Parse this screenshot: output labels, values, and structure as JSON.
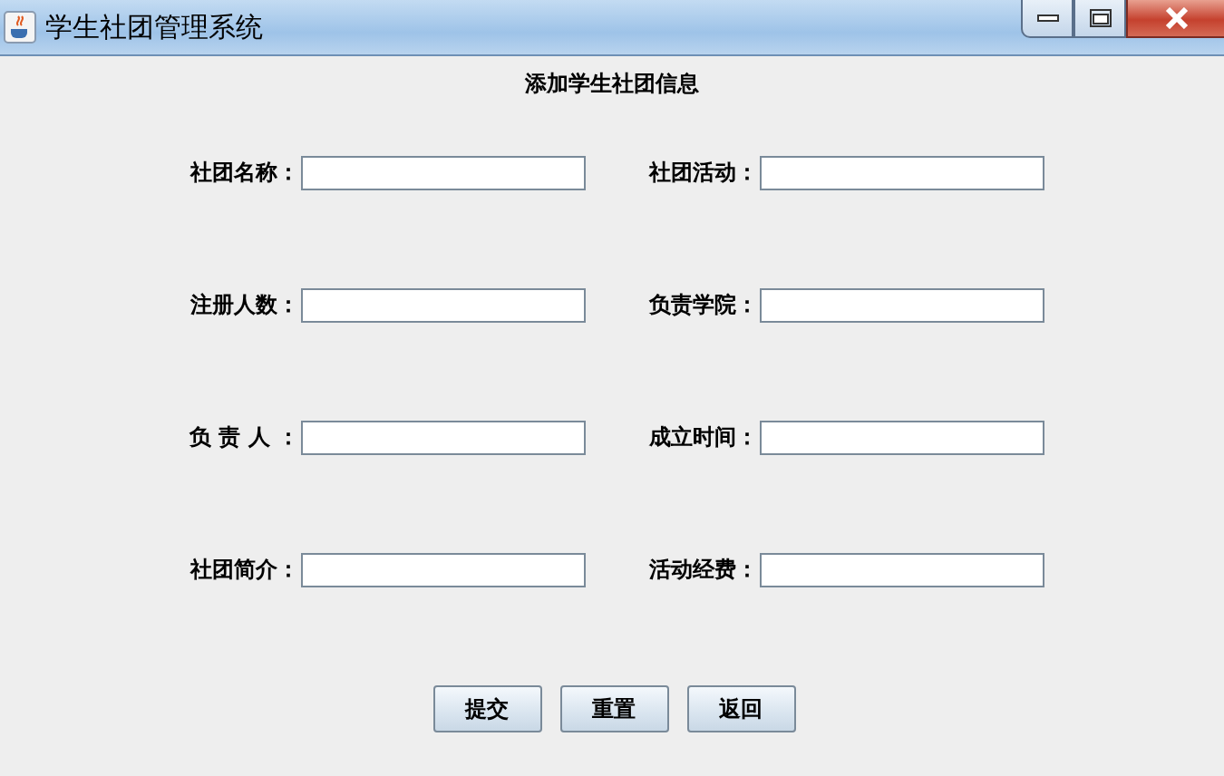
{
  "window": {
    "title": "学生社团管理系统"
  },
  "heading": "添加学生社团信息",
  "fields": [
    {
      "label": "社团名称："
    },
    {
      "label": "社团活动："
    },
    {
      "label": "注册人数："
    },
    {
      "label": "负责学院："
    },
    {
      "label": "负 责 人 ："
    },
    {
      "label": "成立时间："
    },
    {
      "label": "社团简介："
    },
    {
      "label": "活动经费："
    }
  ],
  "buttons": [
    "提交",
    "重置",
    "返回"
  ]
}
